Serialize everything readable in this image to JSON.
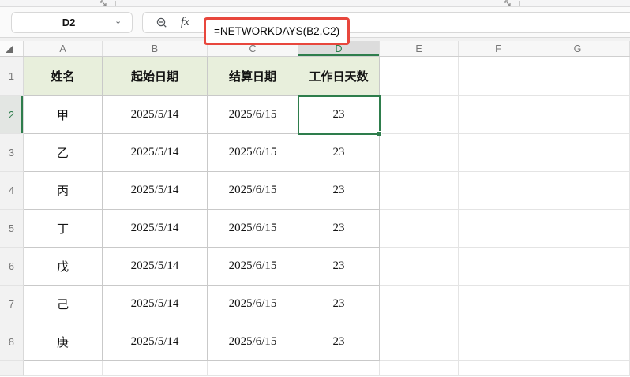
{
  "ribbon": {
    "dialog_launcher_icon": "dialog-launcher"
  },
  "formula_bar": {
    "name_box_value": "D2",
    "chevron_icon": "chevron-down",
    "zoom_out_icon": "magnifier-minus",
    "fx_label": "fx",
    "formula": "=NETWORKDAYS(B2,C2)"
  },
  "colors": {
    "accent_green": "#2e7d4c",
    "annotation_red": "#e8473d",
    "table_header_fill": "#e8efdc",
    "selected_column_header_fill": "#dcdcdc"
  },
  "sheet": {
    "selected_cell": "D2",
    "columns": [
      "A",
      "B",
      "C",
      "D",
      "E",
      "F",
      "G",
      ""
    ],
    "row_numbers": [
      "1",
      "2",
      "3",
      "4",
      "5",
      "6",
      "7",
      "8",
      ""
    ],
    "table_headers": [
      "姓名",
      "起始日期",
      "结算日期",
      "工作日天数"
    ],
    "table_rows": [
      [
        "甲",
        "2025/5/14",
        "2025/6/15",
        "23"
      ],
      [
        "乙",
        "2025/5/14",
        "2025/6/15",
        "23"
      ],
      [
        "丙",
        "2025/5/14",
        "2025/6/15",
        "23"
      ],
      [
        "丁",
        "2025/5/14",
        "2025/6/15",
        "23"
      ],
      [
        "戊",
        "2025/5/14",
        "2025/6/15",
        "23"
      ],
      [
        "己",
        "2025/5/14",
        "2025/6/15",
        "23"
      ],
      [
        "庚",
        "2025/5/14",
        "2025/6/15",
        "23"
      ]
    ]
  }
}
